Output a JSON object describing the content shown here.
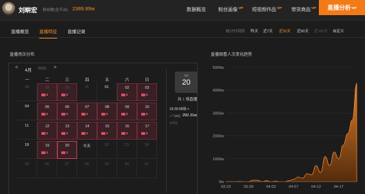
{
  "header": {
    "user_name": "刘畊宏",
    "fans_label": "粉丝数(全平台)",
    "fans_value": "2389.89w",
    "nav": [
      {
        "label": "数据概览",
        "vip": ""
      },
      {
        "label": "粉丝画像",
        "vip": "VIP"
      },
      {
        "label": "短视频作品",
        "vip": "VIP"
      },
      {
        "label": "带货商品",
        "vip": "VIP"
      }
    ],
    "live_analysis": {
      "label": "直播分析",
      "vip": "VIP"
    }
  },
  "subnav": {
    "tabs": [
      "直播概览",
      "直播特征",
      "直播记录"
    ],
    "active_tab": 1,
    "range_label": "统计时间段",
    "ranges": [
      "昨天",
      "近7天",
      "近30天",
      "近90天",
      "近180天",
      "自定义"
    ],
    "active_range": 2
  },
  "calendar": {
    "title": "直播场次分布",
    "prev": "<",
    "next": ">",
    "month": "4月",
    "year": "2022",
    "weekdays": [
      "一",
      "二",
      "三",
      "四",
      "五",
      "六",
      "日"
    ],
    "weeks": [
      [
        {
          "d": "28",
          "o": true
        },
        {
          "d": "29",
          "o": true,
          "n": "1"
        },
        {
          "d": "30",
          "o": true,
          "n": "1"
        },
        {
          "d": "31",
          "o": true
        },
        {
          "d": "01"
        },
        {
          "d": "02",
          "n": "1"
        },
        {
          "d": "03",
          "n": "1"
        }
      ],
      [
        {
          "d": "04"
        },
        {
          "d": "05",
          "n": "1"
        },
        {
          "d": "06",
          "n": "1"
        },
        {
          "d": "07",
          "n": "1"
        },
        {
          "d": "08",
          "n": "1"
        },
        {
          "d": "09",
          "n": "1"
        },
        {
          "d": "10",
          "n": "1"
        }
      ],
      [
        {
          "d": "11"
        },
        {
          "d": "12",
          "n": "1"
        },
        {
          "d": "13",
          "n": "1"
        },
        {
          "d": "14",
          "n": "1"
        },
        {
          "d": "15",
          "n": "1"
        },
        {
          "d": "16",
          "n": "1"
        },
        {
          "d": "17",
          "n": "1"
        }
      ],
      [
        {
          "d": "18"
        },
        {
          "d": "19",
          "n": "1"
        },
        {
          "d": "20",
          "n": "1",
          "sel": true
        },
        {
          "d": "今天"
        },
        {
          "d": "22",
          "o": true
        },
        {
          "d": "23",
          "o": true
        },
        {
          "d": "24",
          "o": true
        }
      ],
      [
        {
          "d": "25",
          "o": true
        },
        {
          "d": "26",
          "o": true
        },
        {
          "d": "27",
          "o": true
        },
        {
          "d": "28",
          "o": true
        },
        {
          "d": "29",
          "o": true
        },
        {
          "d": "30",
          "o": true
        },
        {
          "d": "01",
          "o": true
        }
      ]
    ],
    "detail": {
      "month": "Apr",
      "day": "20",
      "total_prefix": "共 ",
      "total_count": "1",
      "total_suffix": " 场直播",
      "session": "19:30:08场  >",
      "pop_label": "人气峰值",
      "pop_value": "292.31w",
      "unknown": "未知型"
    }
  },
  "chart_data": {
    "type": "area",
    "title": "直播观看人次变化趋势",
    "xlabel": "",
    "ylabel": "",
    "ylim": [
      0,
      5000
    ],
    "y_unit": "w",
    "yticks": [
      "0w",
      "1000w",
      "2000w",
      "3000w",
      "4000w",
      "5000w"
    ],
    "xticks": [
      "03-23",
      "03-28",
      "04-02",
      "04-07",
      "04-12",
      "04-17"
    ],
    "x": [
      "03-23",
      "03-24",
      "03-25",
      "03-26",
      "03-27",
      "03-28",
      "03-29",
      "03-30",
      "03-31",
      "04-01",
      "04-02",
      "04-03",
      "04-04",
      "04-05",
      "04-06",
      "04-07",
      "04-08",
      "04-09",
      "04-10",
      "04-11",
      "04-12",
      "04-13",
      "04-14",
      "04-15",
      "04-16",
      "04-17",
      "04-18",
      "04-19",
      "04-20",
      "04-21"
    ],
    "values": [
      0,
      5,
      0,
      10,
      0,
      0,
      60,
      60,
      0,
      40,
      0,
      20,
      0,
      0,
      40,
      100,
      200,
      150,
      350,
      300,
      700,
      400,
      1100,
      700,
      1300,
      1000,
      1600,
      2100,
      2700,
      4300
    ],
    "color": "#f0852a",
    "grid": true
  }
}
